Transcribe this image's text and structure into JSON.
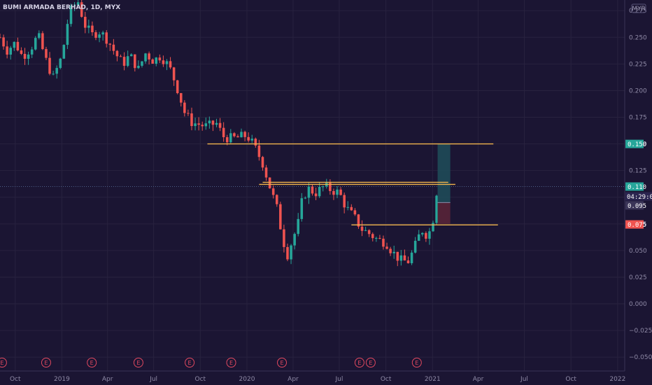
{
  "symbol_title": "BUMI ARMADA BERHAD, 1D, MYX",
  "currency": "MYR",
  "price_tags": {
    "target": "0.150",
    "last": "0.110",
    "countdown": "04:29:06",
    "entry": "0.095",
    "stop": "0.075"
  },
  "colors": {
    "background": "#1b1533",
    "grid": "#28223f",
    "bull": "#26a69a",
    "bear": "#ef5350",
    "level_line": "#f0b44c",
    "target_tag": "#26a69a",
    "last_tag": "#26a69a",
    "stop_tag": "#ef5350",
    "event": "#e0485f"
  },
  "events": [
    "E",
    "E",
    "E",
    "E",
    "E",
    "E",
    "E",
    "E",
    "E",
    "E"
  ],
  "chart_data": {
    "type": "candlestick",
    "title": "BUMI ARMADA BERHAD, 1D, MYX",
    "y_ticks": [
      "0.275",
      "0.250",
      "0.225",
      "0.200",
      "0.175",
      "0.150",
      "0.125",
      "0.100",
      "0.075",
      "0.050",
      "0.025",
      "0.000",
      "−0.025",
      "−0.050"
    ],
    "y_tick_values": [
      0.275,
      0.25,
      0.225,
      0.2,
      0.175,
      0.15,
      0.125,
      0.1,
      0.075,
      0.05,
      0.025,
      0.0,
      -0.025,
      -0.05
    ],
    "ylim": [
      -0.063,
      0.285
    ],
    "x_ticks": [
      "Oct",
      "2019",
      "Apr",
      "Jul",
      "Oct",
      "2020",
      "Apr",
      "Jul",
      "Oct",
      "2021",
      "Apr",
      "Jul",
      "Oct",
      "2022"
    ],
    "x_tick_dates": [
      "2018-10-01",
      "2019-01-01",
      "2019-04-01",
      "2019-07-01",
      "2019-10-01",
      "2020-01-01",
      "2020-04-01",
      "2020-07-01",
      "2020-10-01",
      "2021-01-01",
      "2021-04-01",
      "2021-07-01",
      "2021-10-01",
      "2022-01-01"
    ],
    "xlim": [
      "2018-09-01",
      "2022-01-15"
    ],
    "last_price": 0.11,
    "series_path": [
      [
        "2018-09-01",
        0.25
      ],
      [
        "2018-09-15",
        0.238
      ],
      [
        "2018-10-01",
        0.245
      ],
      [
        "2018-10-15",
        0.232
      ],
      [
        "2018-11-01",
        0.24
      ],
      [
        "2018-11-15",
        0.252
      ],
      [
        "2018-12-01",
        0.228
      ],
      [
        "2018-12-15",
        0.212
      ],
      [
        "2019-01-01",
        0.232
      ],
      [
        "2019-01-15",
        0.272
      ],
      [
        "2019-02-01",
        0.285
      ],
      [
        "2019-02-15",
        0.262
      ],
      [
        "2019-03-01",
        0.252
      ],
      [
        "2019-03-15",
        0.256
      ],
      [
        "2019-04-01",
        0.248
      ],
      [
        "2019-04-15",
        0.236
      ],
      [
        "2019-05-01",
        0.225
      ],
      [
        "2019-05-15",
        0.233
      ],
      [
        "2019-06-01",
        0.22
      ],
      [
        "2019-06-15",
        0.235
      ],
      [
        "2019-07-01",
        0.228
      ],
      [
        "2019-07-15",
        0.233
      ],
      [
        "2019-08-01",
        0.222
      ],
      [
        "2019-08-15",
        0.205
      ],
      [
        "2019-09-01",
        0.178
      ],
      [
        "2019-09-15",
        0.17
      ],
      [
        "2019-10-01",
        0.168
      ],
      [
        "2019-10-15",
        0.166
      ],
      [
        "2019-11-01",
        0.17
      ],
      [
        "2019-11-15",
        0.157
      ],
      [
        "2019-12-01",
        0.155
      ],
      [
        "2019-12-15",
        0.156
      ],
      [
        "2020-01-01",
        0.158
      ],
      [
        "2020-01-15",
        0.148
      ],
      [
        "2020-02-01",
        0.132
      ],
      [
        "2020-02-15",
        0.11
      ],
      [
        "2020-03-01",
        0.088
      ],
      [
        "2020-03-10",
        0.065
      ],
      [
        "2020-03-20",
        0.045
      ],
      [
        "2020-04-01",
        0.062
      ],
      [
        "2020-04-10",
        0.073
      ],
      [
        "2020-04-20",
        0.1
      ],
      [
        "2020-05-01",
        0.108
      ],
      [
        "2020-05-15",
        0.104
      ],
      [
        "2020-06-01",
        0.11
      ],
      [
        "2020-06-15",
        0.107
      ],
      [
        "2020-07-01",
        0.104
      ],
      [
        "2020-07-15",
        0.09
      ],
      [
        "2020-08-01",
        0.08
      ],
      [
        "2020-08-15",
        0.07
      ],
      [
        "2020-09-01",
        0.065
      ],
      [
        "2020-09-15",
        0.06
      ],
      [
        "2020-10-01",
        0.058
      ],
      [
        "2020-10-15",
        0.048
      ],
      [
        "2020-11-01",
        0.04
      ],
      [
        "2020-11-15",
        0.04
      ],
      [
        "2020-12-01",
        0.058
      ],
      [
        "2020-12-10",
        0.07
      ],
      [
        "2020-12-20",
        0.065
      ],
      [
        "2020-12-31",
        0.07
      ],
      [
        "2021-01-05",
        0.095
      ],
      [
        "2021-01-11",
        0.11
      ]
    ],
    "horizontal_levels": [
      {
        "price": 0.15,
        "from": "2019-10-15",
        "to": "2021-05-01"
      },
      {
        "price": 0.114,
        "from": "2020-02-01",
        "to": "2021-02-01"
      },
      {
        "price": 0.112,
        "from": "2020-01-25",
        "to": "2021-02-15"
      },
      {
        "price": 0.074,
        "from": "2020-07-25",
        "to": "2021-05-10"
      }
    ],
    "position": {
      "entry": 0.095,
      "target": 0.15,
      "stop": 0.075,
      "from": "2021-01-11",
      "to": "2021-02-05"
    },
    "event_dates": [
      "2018-09-05",
      "2018-12-01",
      "2019-03-01",
      "2019-06-01",
      "2019-09-10",
      "2019-12-01",
      "2020-03-10",
      "2020-08-10",
      "2020-09-01",
      "2020-12-01"
    ]
  }
}
